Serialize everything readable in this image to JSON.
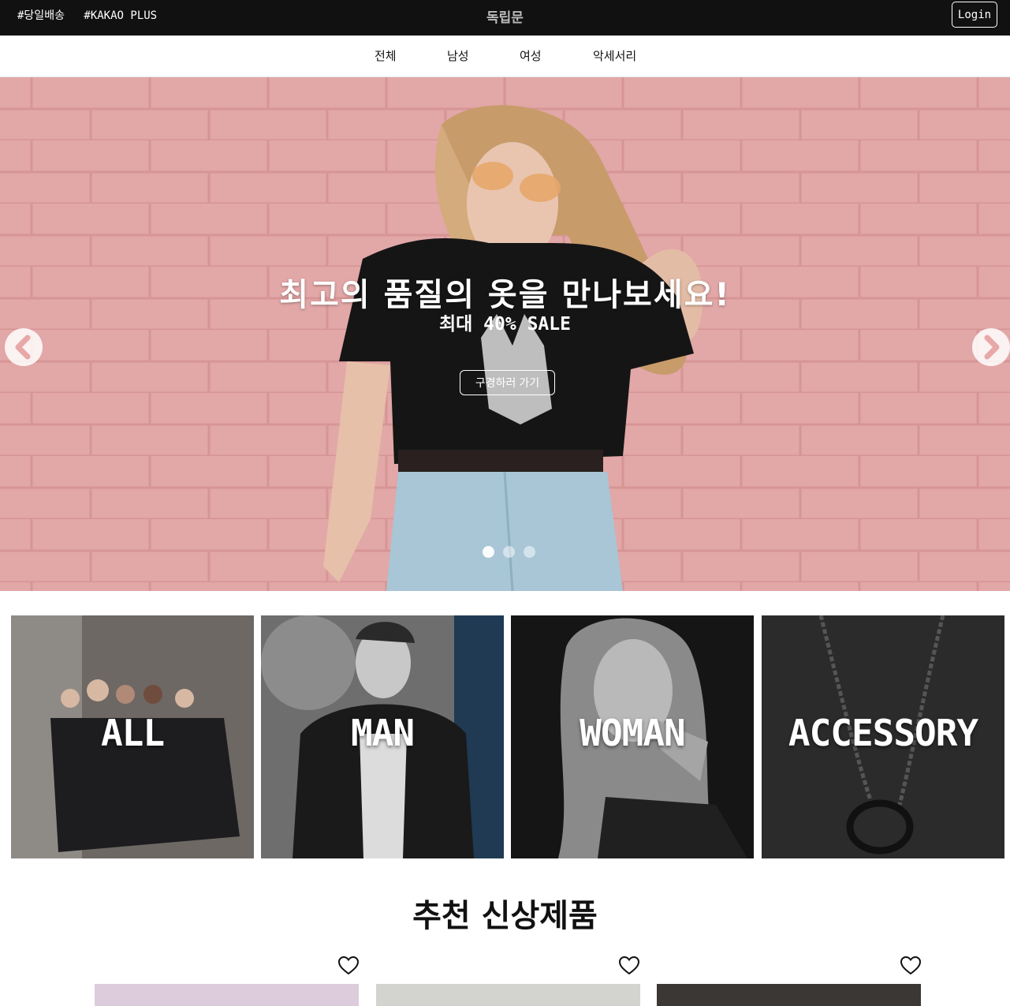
{
  "topbar": {
    "tags": [
      "#당일배송",
      "#KAKAO PLUS"
    ],
    "brand": "독립문",
    "login_label": "Login"
  },
  "nav": {
    "items": [
      "전체",
      "남성",
      "여성",
      "악세서리"
    ]
  },
  "hero": {
    "title": "최고의 품질의 옷을 만나보세요!",
    "subtitle": "최대 40% SALE",
    "button_label": "구경하러 가기",
    "slide_count": 3,
    "active_slide": 1
  },
  "categories": [
    {
      "label": "ALL"
    },
    {
      "label": "MAN"
    },
    {
      "label": "WOMAN"
    },
    {
      "label": "ACCESSORY"
    }
  ],
  "section": {
    "title": "추천 신상제품"
  },
  "colors": {
    "topbar_bg": "#111111",
    "hero_bg": "#e1a6a6",
    "text": "#111111",
    "white": "#ffffff"
  }
}
